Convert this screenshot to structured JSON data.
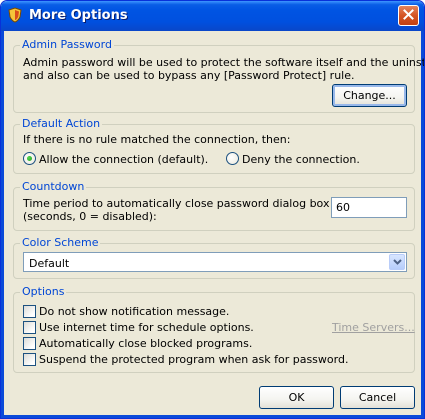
{
  "window": {
    "title": "More Options"
  },
  "admin_password": {
    "legend": "Admin Password",
    "description_line1": "Admin password will be used to protect the software itself and the uninstaller,",
    "description_line2": "and also can be used to bypass any [Password Protect] rule.",
    "change_button": "Change..."
  },
  "default_action": {
    "legend": "Default Action",
    "prompt": "If there is no rule matched the connection, then:",
    "allow_label": "Allow the connection (default).",
    "deny_label": "Deny the connection.",
    "selected": "allow"
  },
  "countdown": {
    "legend": "Countdown",
    "label_line1": "Time period to automatically close password dialog box",
    "label_line2": "(seconds, 0 = disabled):",
    "value": "60"
  },
  "color_scheme": {
    "legend": "Color Scheme",
    "selected": "Default"
  },
  "options": {
    "legend": "Options",
    "items": [
      {
        "label": "Do not show notification message.",
        "checked": false
      },
      {
        "label": "Use internet time for schedule options.",
        "checked": false
      },
      {
        "label": "Automatically close blocked programs.",
        "checked": false
      },
      {
        "label": "Suspend the protected program when ask for password.",
        "checked": false
      }
    ],
    "time_servers_link": "Time Servers..."
  },
  "footer": {
    "ok_button": "OK",
    "cancel_button": "Cancel"
  },
  "icons": {
    "app": "shield-icon",
    "close": "close-icon",
    "dropdown": "chevron-down-icon"
  }
}
